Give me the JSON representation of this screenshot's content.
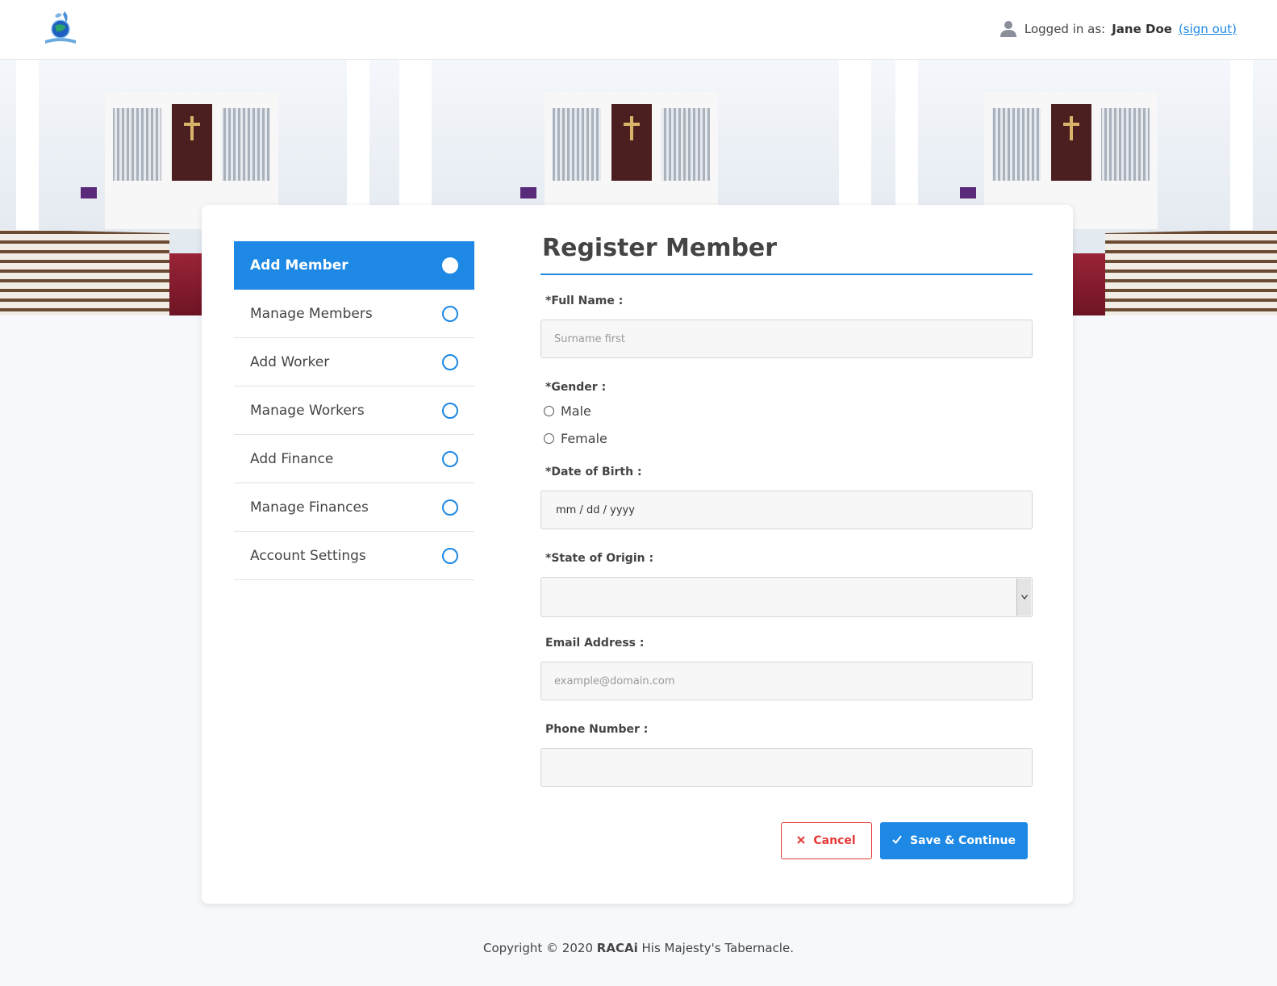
{
  "header": {
    "logo_icon": "church-globe-logo",
    "user_icon": "user-icon",
    "logged_in_prefix": "Logged in as:",
    "user_name": "Jane Doe",
    "sign_out": "(sign out)"
  },
  "sidebar": {
    "items": [
      {
        "label": "Add Member",
        "active": true
      },
      {
        "label": "Manage Members",
        "active": false
      },
      {
        "label": "Add Worker",
        "active": false
      },
      {
        "label": "Manage Workers",
        "active": false
      },
      {
        "label": "Add Finance",
        "active": false
      },
      {
        "label": "Manage Finances",
        "active": false
      },
      {
        "label": "Account Settings",
        "active": false
      }
    ]
  },
  "form": {
    "title": "Register Member",
    "full_name_label": "*Full Name :",
    "full_name_placeholder": "Surname first",
    "gender_label": "*Gender :",
    "gender_options": [
      "Male",
      "Female"
    ],
    "dob_label": "*Date of Birth :",
    "dob_placeholder": "mm / dd / yyyy",
    "state_label": "*State of Origin :",
    "state_value": "",
    "email_label": "Email Address :",
    "email_placeholder": "example@domain.com",
    "phone_label": "Phone Number :",
    "phone_value": "",
    "cancel_label": "Cancel",
    "save_label": "Save & Continue"
  },
  "footer": {
    "prefix": "Copyright © 2020",
    "brand": "RACAi",
    "suffix": "His Majesty's Tabernacle."
  },
  "colors": {
    "accent": "#1e88e5",
    "danger": "#e53935",
    "background": "#f6f8fb"
  }
}
